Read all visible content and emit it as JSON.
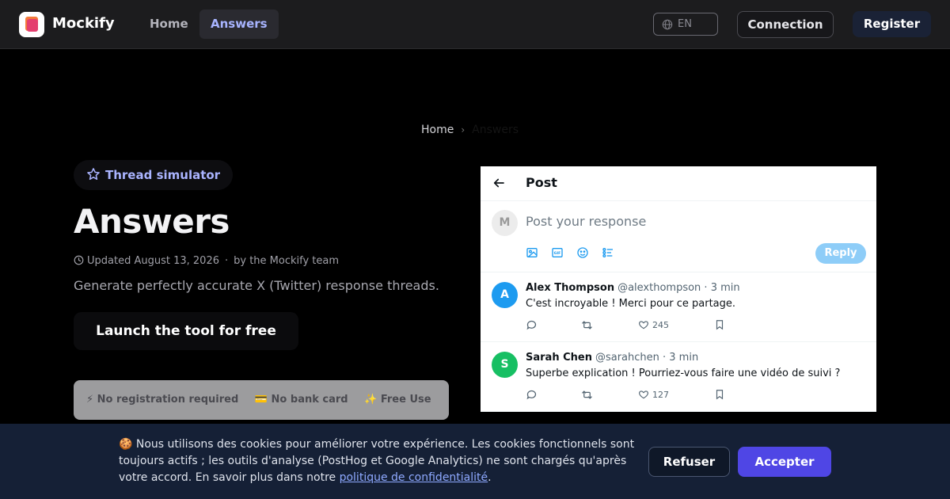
{
  "nav": {
    "brand": "Mockify",
    "links": [
      {
        "label": "Home"
      },
      {
        "label": "Answers"
      }
    ],
    "language": "EN",
    "connection_label": "Connection",
    "register_label": "Register"
  },
  "breadcrumb": {
    "home": "Home",
    "current": "Answers"
  },
  "hero": {
    "pill_label": "Thread simulator",
    "title": "Answers",
    "updated": "Updated August 13, 2026",
    "author": "by the Mockify team",
    "subtitle": "Generate perfectly accurate X (Twitter) response threads.",
    "cta_label": "Launch the tool for free",
    "features": [
      {
        "icon": "⚡",
        "label": "No registration required"
      },
      {
        "icon": "💳",
        "label": "No bank card"
      },
      {
        "icon": "✨",
        "label": "Free Use"
      }
    ]
  },
  "post_card": {
    "title": "Post",
    "compose_avatar": "M",
    "compose_placeholder": "Post your response",
    "reply_label": "Reply",
    "replies": [
      {
        "avatar": "A",
        "avatar_color": "#1d9bf0",
        "name": "Alex Thompson",
        "handle": "@alexthompson · 3 min",
        "text": "C'est incroyable ! Merci pour ce partage.",
        "likes": "245"
      },
      {
        "avatar": "S",
        "avatar_color": "#17bf63",
        "name": "Sarah Chen",
        "handle": "@sarahchen · 3 min",
        "text": "Superbe explication ! Pourriez-vous faire une vidéo de suivi ?",
        "likes": "127"
      }
    ]
  },
  "cookie": {
    "text": "🍪 Nous utilisons des cookies pour améliorer votre expérience. Les cookies fonctionnels sont toujours actifs ; les outils d'analyse (PostHog et Google Analytics) ne sont chargés qu'après votre accord. En savoir plus dans notre ",
    "link_label": "politique de confidentialité",
    "text_end": ".",
    "refuse_label": "Refuser",
    "accept_label": "Accepter"
  }
}
